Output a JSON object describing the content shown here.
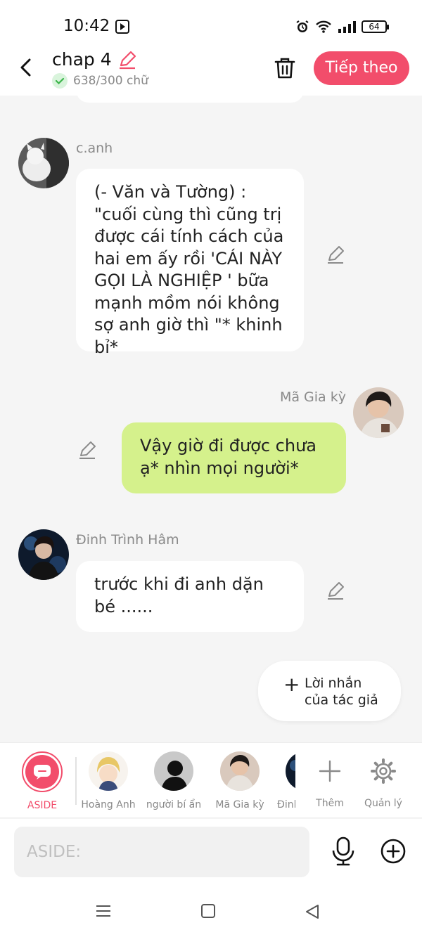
{
  "status_bar": {
    "time": "10:42",
    "battery": "64"
  },
  "header": {
    "title": "chap 4",
    "word_count": "638/300 chữ",
    "next_button": "Tiếp theo"
  },
  "messages": [
    {
      "sender": "c.anh",
      "side": "left",
      "text": "(- Văn và Tường) : \"cuối cùng thì cũng trị được cái tính cách của hai em ấy rồi 'CÁI NÀY GỌI LÀ NGHIỆP ' bữa mạnh mồm nói không sợ anh giờ thì \"* khinh bỉ*"
    },
    {
      "sender": "Mã Gia kỳ",
      "side": "right",
      "text": "Vậy giờ đi được chưa ạ* nhìn mọi người*"
    },
    {
      "sender": "Đinh Trình Hâm",
      "side": "left",
      "text": "trước khi đi anh dặn bé ......"
    }
  ],
  "author_note_button": "Lời nhắn của tác giả",
  "characters": [
    {
      "label": "ASIDE",
      "active": true
    },
    {
      "label": "Hoàng Anh"
    },
    {
      "label": "người bí ẩn"
    },
    {
      "label": "Mã Gia kỳ"
    },
    {
      "label": "Đinh"
    }
  ],
  "char_actions": {
    "add": "Thêm",
    "manage": "Quản lý"
  },
  "input": {
    "placeholder": "ASIDE:"
  },
  "colors": {
    "accent": "#f24d6b",
    "my_bubble": "#d5f18c",
    "background": "#f5f5f5"
  }
}
